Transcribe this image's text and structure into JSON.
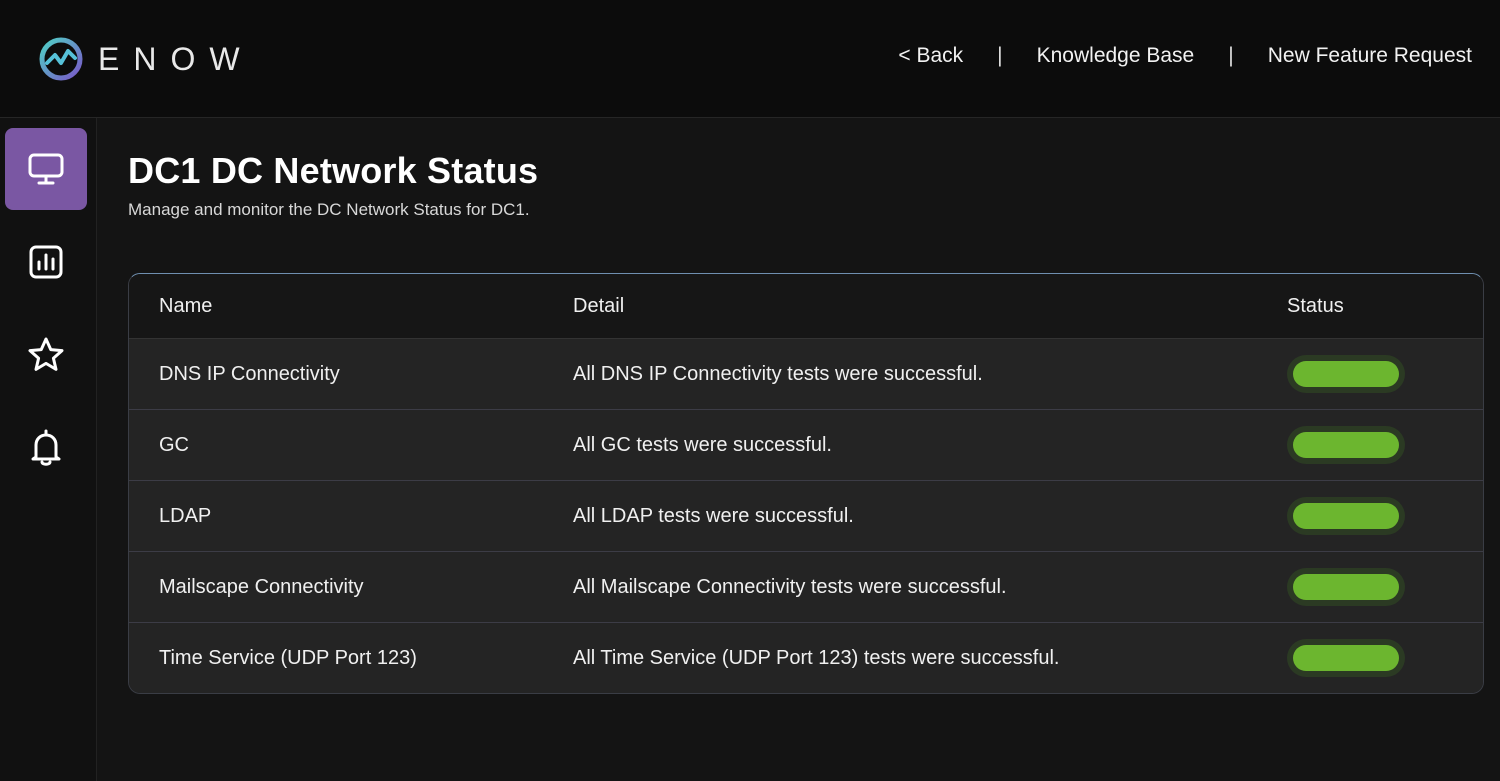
{
  "app": {
    "logo_text": "ENOW"
  },
  "nav": {
    "back": "< Back",
    "sep": "|",
    "kb": "Knowledge Base",
    "feature": "New Feature Request"
  },
  "sidebar": {
    "items": [
      {
        "icon": "monitor-icon",
        "active": true
      },
      {
        "icon": "chart-icon",
        "active": false
      },
      {
        "icon": "star-icon",
        "active": false
      },
      {
        "icon": "bell-icon",
        "active": false
      }
    ]
  },
  "page": {
    "title": "DC1 DC Network Status",
    "subtitle": "Manage and monitor the DC Network Status for DC1."
  },
  "table": {
    "headers": {
      "name": "Name",
      "detail": "Detail",
      "status": "Status"
    },
    "rows": [
      {
        "name": "DNS IP Connectivity",
        "detail": "All DNS IP Connectivity tests were successful.",
        "status": "success"
      },
      {
        "name": "GC",
        "detail": "All GC tests were successful.",
        "status": "success"
      },
      {
        "name": "LDAP",
        "detail": "All LDAP tests were successful.",
        "status": "success"
      },
      {
        "name": "Mailscape Connectivity",
        "detail": "All Mailscape Connectivity tests were successful.",
        "status": "success"
      },
      {
        "name": "Time Service (UDP Port 123)",
        "detail": "All Time Service (UDP Port 123) tests were successful.",
        "status": "success"
      }
    ]
  },
  "colors": {
    "accent": "#7a57a3",
    "success": "#6cb62f",
    "background": "#141414"
  }
}
